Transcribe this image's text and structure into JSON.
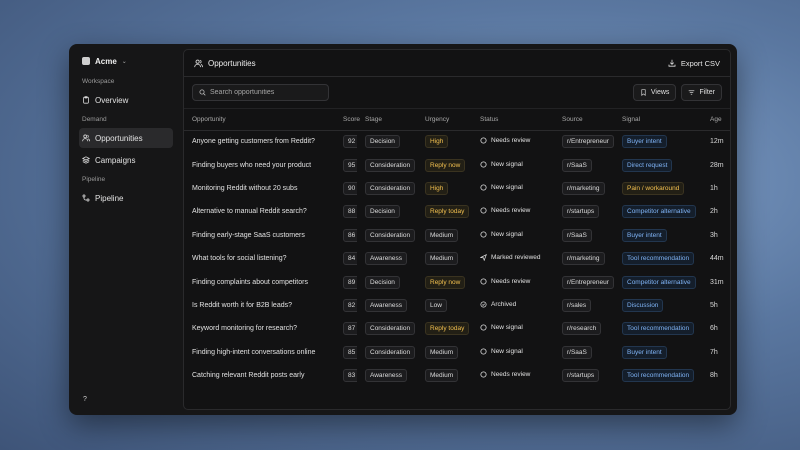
{
  "sidebar": {
    "brand": "Acme",
    "sections": [
      {
        "label": "Workspace",
        "items": [
          {
            "label": "Overview",
            "icon": "clipboard-icon"
          }
        ]
      },
      {
        "label": "Demand",
        "items": [
          {
            "label": "Opportunities",
            "icon": "users-icon",
            "active": true
          },
          {
            "label": "Campaigns",
            "icon": "layers-icon"
          }
        ]
      },
      {
        "label": "Pipeline",
        "items": [
          {
            "label": "Pipeline",
            "icon": "branch-icon"
          }
        ]
      }
    ],
    "help": "?"
  },
  "header": {
    "title": "Opportunities",
    "export_label": "Export CSV"
  },
  "toolbar": {
    "search_placeholder": "Search opportunities",
    "views_label": "Views",
    "filter_label": "Filter"
  },
  "table": {
    "columns": [
      "Opportunity",
      "Score",
      "Stage",
      "Urgency",
      "Status",
      "Source",
      "Signal",
      "Age"
    ],
    "rows": [
      {
        "opportunity": "Anyone getting customers from Reddit?",
        "score": "92",
        "stage": "Decision",
        "urgency": "High",
        "status": "Needs review",
        "source": "r/Entrepreneur",
        "signal": "Buyer intent",
        "age": "12m"
      },
      {
        "opportunity": "Finding buyers who need your product",
        "score": "95",
        "stage": "Consideration",
        "urgency": "Reply now",
        "status": "New signal",
        "source": "r/SaaS",
        "signal": "Direct request",
        "age": "28m"
      },
      {
        "opportunity": "Monitoring Reddit without 20 subs",
        "score": "90",
        "stage": "Consideration",
        "urgency": "High",
        "status": "New signal",
        "source": "r/marketing",
        "signal": "Pain / workaround",
        "age": "1h"
      },
      {
        "opportunity": "Alternative to manual Reddit search?",
        "score": "88",
        "stage": "Decision",
        "urgency": "Reply today",
        "status": "Needs review",
        "source": "r/startups",
        "signal": "Competitor alternative",
        "age": "2h"
      },
      {
        "opportunity": "Finding early-stage SaaS customers",
        "score": "86",
        "stage": "Consideration",
        "urgency": "Medium",
        "status": "New signal",
        "source": "r/SaaS",
        "signal": "Buyer intent",
        "age": "3h"
      },
      {
        "opportunity": "What tools for social listening?",
        "score": "84",
        "stage": "Awareness",
        "urgency": "Medium",
        "status": "Marked reviewed",
        "source": "r/marketing",
        "signal": "Tool recommendation",
        "age": "44m"
      },
      {
        "opportunity": "Finding complaints about competitors",
        "score": "89",
        "stage": "Decision",
        "urgency": "Reply now",
        "status": "Needs review",
        "source": "r/Entrepreneur",
        "signal": "Competitor alternative",
        "age": "31m"
      },
      {
        "opportunity": "Is Reddit worth it for B2B leads?",
        "score": "82",
        "stage": "Awareness",
        "urgency": "Low",
        "status": "Archived",
        "source": "r/sales",
        "signal": "Discussion",
        "age": "5h"
      },
      {
        "opportunity": "Keyword monitoring for research?",
        "score": "87",
        "stage": "Consideration",
        "urgency": "Reply today",
        "status": "New signal",
        "source": "r/research",
        "signal": "Tool recommendation",
        "age": "6h"
      },
      {
        "opportunity": "Finding high-intent conversations online",
        "score": "85",
        "stage": "Consideration",
        "urgency": "Medium",
        "status": "New signal",
        "source": "r/SaaS",
        "signal": "Buyer intent",
        "age": "7h"
      },
      {
        "opportunity": "Catching relevant Reddit posts early",
        "score": "83",
        "stage": "Awareness",
        "urgency": "Medium",
        "status": "Needs review",
        "source": "r/startups",
        "signal": "Tool recommendation",
        "age": "8h"
      }
    ]
  },
  "colors": {
    "accent_blue": "#7fb3f5",
    "warning_yellow": "#f3c04f",
    "panel_bg": "#121213"
  }
}
